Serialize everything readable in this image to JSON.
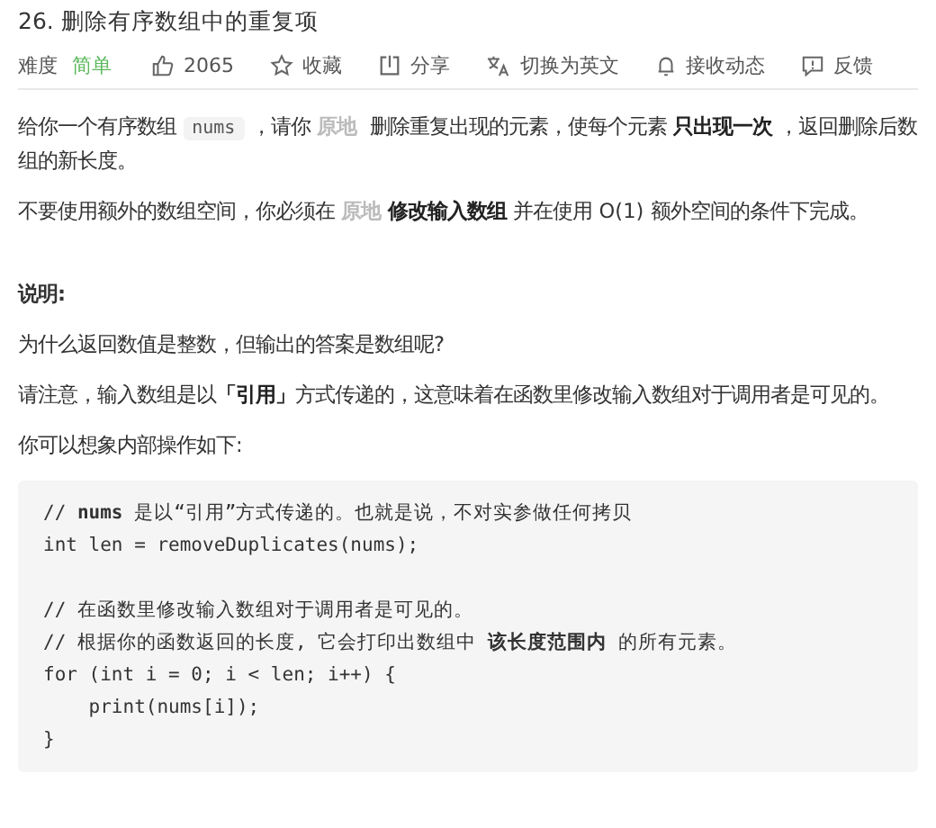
{
  "title": "26. 删除有序数组中的重复项",
  "toolbar": {
    "difficulty_label": "难度",
    "difficulty": "简单",
    "actions": [
      {
        "kind": "like",
        "label": "2065"
      },
      {
        "kind": "star",
        "label": "收藏"
      },
      {
        "kind": "share",
        "label": "分享"
      },
      {
        "kind": "translate",
        "label": "切换为英文"
      },
      {
        "kind": "bell",
        "label": "接收动态"
      },
      {
        "kind": "feedback",
        "label": "反馈"
      }
    ]
  },
  "description": [
    {
      "kind": "paragraph",
      "segments": [
        {
          "kind": "text",
          "text": "给你一个有序数组 "
        },
        {
          "kind": "code",
          "text": "nums"
        },
        {
          "kind": "text",
          "text": " ，请你 "
        },
        {
          "kind": "mark",
          "text": "原地"
        },
        {
          "kind": "text",
          "text": " 删除重复出现的元素，使每个元素 "
        },
        {
          "kind": "bold",
          "text": "只出现一次"
        },
        {
          "kind": "text",
          "text": " ，返回删除后数组的新长度。"
        }
      ]
    },
    {
      "kind": "paragraph",
      "segments": [
        {
          "kind": "text",
          "text": "不要使用额外的数组空间，你必须在 "
        },
        {
          "kind": "mark",
          "text": "原地"
        },
        {
          "kind": "bold",
          "text": "修改输入数组"
        },
        {
          "kind": "text",
          "text": " 并在使用 O(1) 额外空间的条件下完成。"
        }
      ]
    },
    {
      "kind": "heading",
      "segments": [
        {
          "kind": "text",
          "text": "说明:"
        }
      ]
    },
    {
      "kind": "paragraph",
      "segments": [
        {
          "kind": "text",
          "text": "为什么返回数值是整数，但输出的答案是数组呢?"
        }
      ]
    },
    {
      "kind": "paragraph",
      "segments": [
        {
          "kind": "text",
          "text": "请注意，输入数组是以"
        },
        {
          "kind": "bold",
          "text": "「引用」"
        },
        {
          "kind": "text",
          "text": "方式传递的，这意味着在函数里修改输入数组对于调用者是可见的。"
        }
      ]
    },
    {
      "kind": "paragraph",
      "segments": [
        {
          "kind": "text",
          "text": "你可以想象内部操作如下:"
        }
      ]
    }
  ],
  "code_groups": [
    [
      "// **nums** 是以“引用”方式传递的。也就是说，不对实参做任何拷贝",
      "int len = removeDuplicates(nums);"
    ],
    [
      "// 在函数里修改输入数组对于调用者是可见的。",
      "// 根据你的函数返回的长度, 它会打印出数组中 **该长度范围内** 的所有元素。",
      "for (int i = 0; i < len; i++) {",
      "    print(nums[i]);",
      "}"
    ]
  ]
}
